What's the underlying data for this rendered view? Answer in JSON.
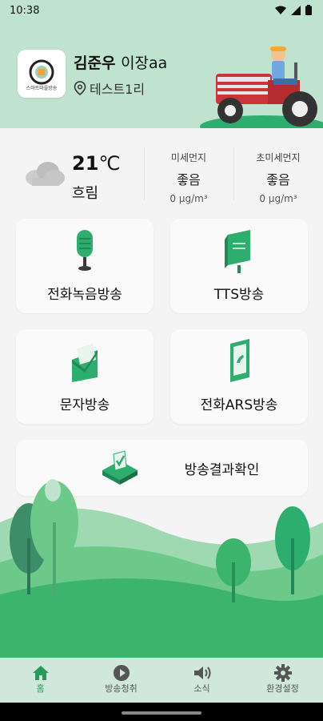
{
  "status": {
    "time": "10:38"
  },
  "header": {
    "logo_text": "스마트마을방송",
    "user_name": "김준우",
    "user_role": "이장aa",
    "location": "테스트1리"
  },
  "weather": {
    "temperature": "21",
    "unit": "℃",
    "condition": "흐림",
    "fine_dust": {
      "title": "미세먼지",
      "status": "좋음",
      "value": "0 μg/m³"
    },
    "ultra_fine_dust": {
      "title": "초미세먼지",
      "status": "좋음",
      "value": "0 μg/m³"
    }
  },
  "menu": {
    "phone_record": "전화녹음방송",
    "tts": "TTS방송",
    "text": "문자방송",
    "phone_ars": "전화ARS방송",
    "result": "방송결과확인"
  },
  "nav": [
    {
      "label": "홈",
      "icon": "home-icon",
      "active": true
    },
    {
      "label": "방송청취",
      "icon": "play-icon",
      "active": false
    },
    {
      "label": "소식",
      "icon": "speaker-icon",
      "active": false
    },
    {
      "label": "환경설정",
      "icon": "gear-icon",
      "active": false
    }
  ],
  "colors": {
    "accent": "#2A9A5C",
    "header_bg": "#BFE3CF",
    "icon_green": "#2DAE6E"
  }
}
